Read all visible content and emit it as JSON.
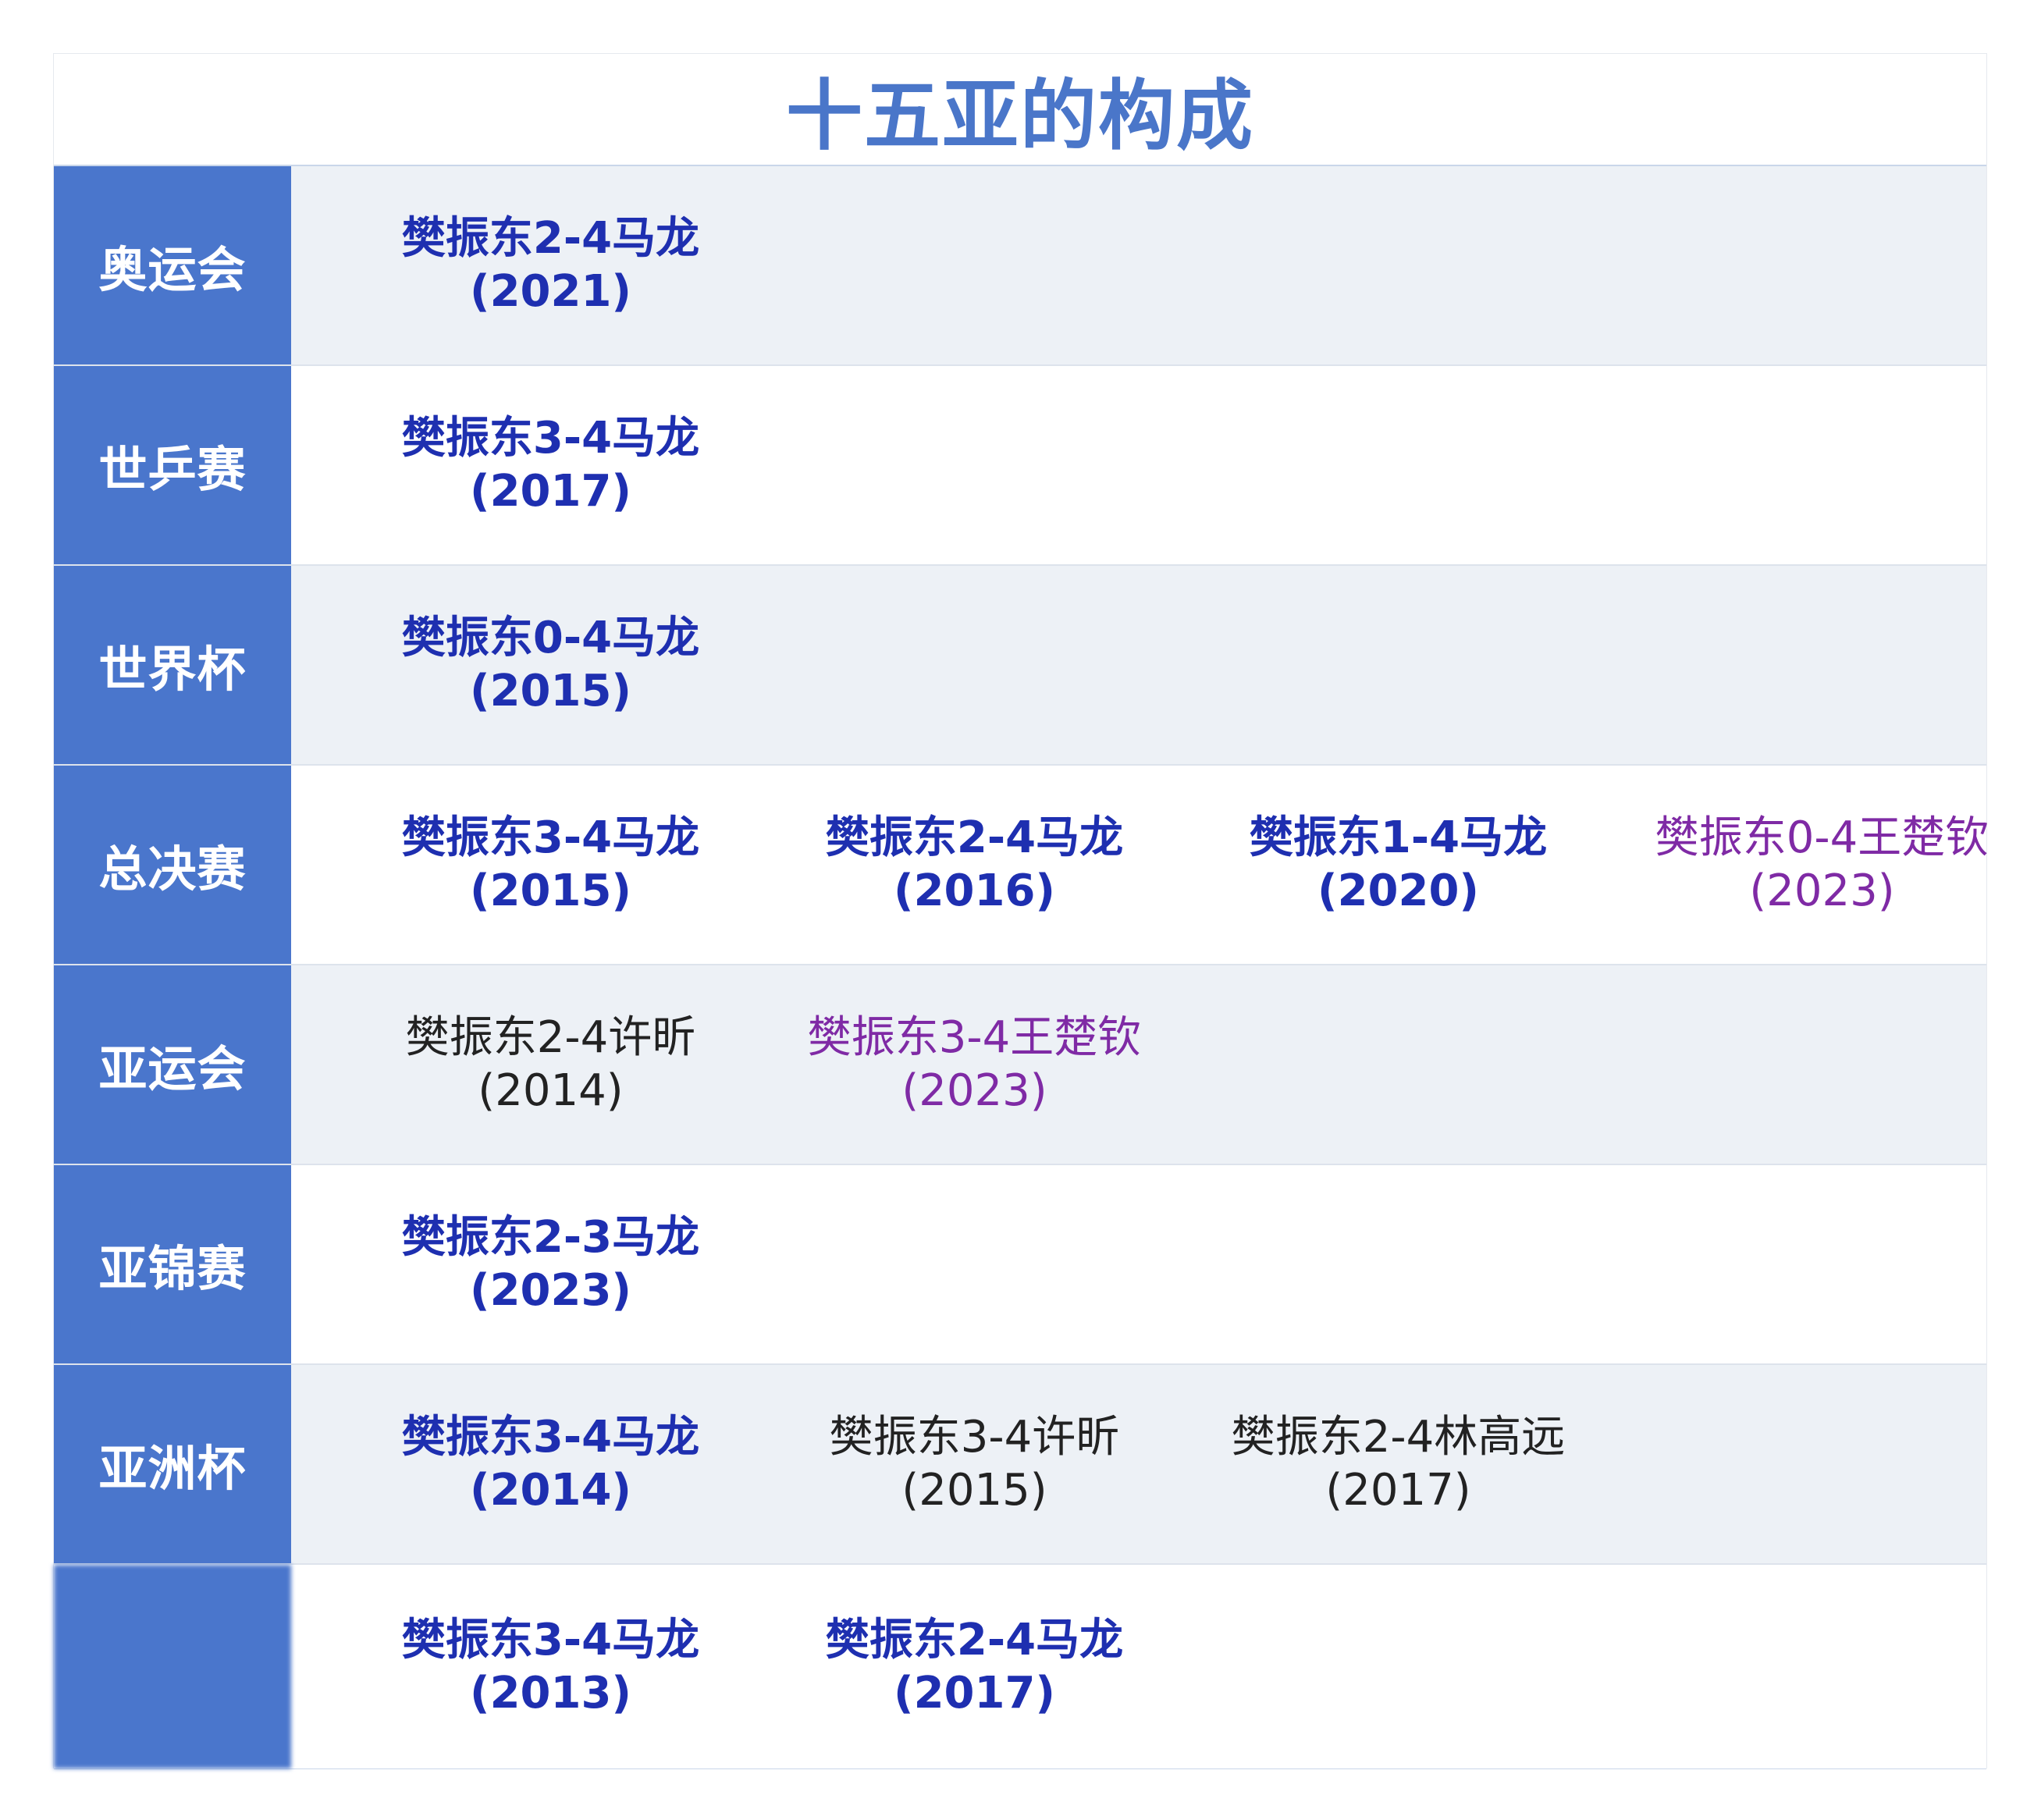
{
  "title": "十五亚的构成",
  "rows": [
    {
      "label": "奥运会",
      "entries": [
        {
          "text": "樊振东2-4马龙",
          "year": "(2021)",
          "style": "bold-blue"
        }
      ]
    },
    {
      "label": "世乒赛",
      "entries": [
        {
          "text": "樊振东3-4马龙",
          "year": "(2017)",
          "style": "bold-blue"
        }
      ]
    },
    {
      "label": "世界杯",
      "entries": [
        {
          "text": "樊振东0-4马龙",
          "year": "(2015)",
          "style": "bold-blue"
        }
      ]
    },
    {
      "label": "总决赛",
      "entries": [
        {
          "text": "樊振东3-4马龙",
          "year": "(2015)",
          "style": "bold-blue"
        },
        {
          "text": "樊振东2-4马龙",
          "year": "(2016)",
          "style": "bold-blue"
        },
        {
          "text": "樊振东1-4马龙",
          "year": "(2020)",
          "style": "bold-blue"
        },
        {
          "text": "樊振东0-4王楚钦",
          "year": "(2023)",
          "style": "purple"
        }
      ]
    },
    {
      "label": "亚运会",
      "entries": [
        {
          "text": "樊振东2-4许昕",
          "year": "(2014)",
          "style": "black"
        },
        {
          "text": "樊振东3-4王楚钦",
          "year": "(2023)",
          "style": "purple"
        }
      ]
    },
    {
      "label": "亚锦赛",
      "entries": [
        {
          "text": "樊振东2-3马龙",
          "year": "(2023)",
          "style": "bold-blue"
        }
      ]
    },
    {
      "label": "亚洲杯",
      "entries": [
        {
          "text": "樊振东3-4马龙",
          "year": "(2014)",
          "style": "bold-blue"
        },
        {
          "text": "樊振东3-4许昕",
          "year": "(2015)",
          "style": "black"
        },
        {
          "text": "樊振东2-4林高远",
          "year": "(2017)",
          "style": "black"
        }
      ]
    },
    {
      "label": "",
      "entries": [
        {
          "text": "樊振东3-4马龙",
          "year": "(2013)",
          "style": "bold-blue"
        },
        {
          "text": "樊振东2-4马龙",
          "year": "(2017)",
          "style": "bold-blue"
        }
      ]
    }
  ],
  "colors": {
    "title": "#4a76c9",
    "label_bg": "#4a76cc",
    "row_shaded": "#edf1f6",
    "bold_blue": "#1e2fb0",
    "purple": "#7f2aa5",
    "black": "#222222"
  }
}
